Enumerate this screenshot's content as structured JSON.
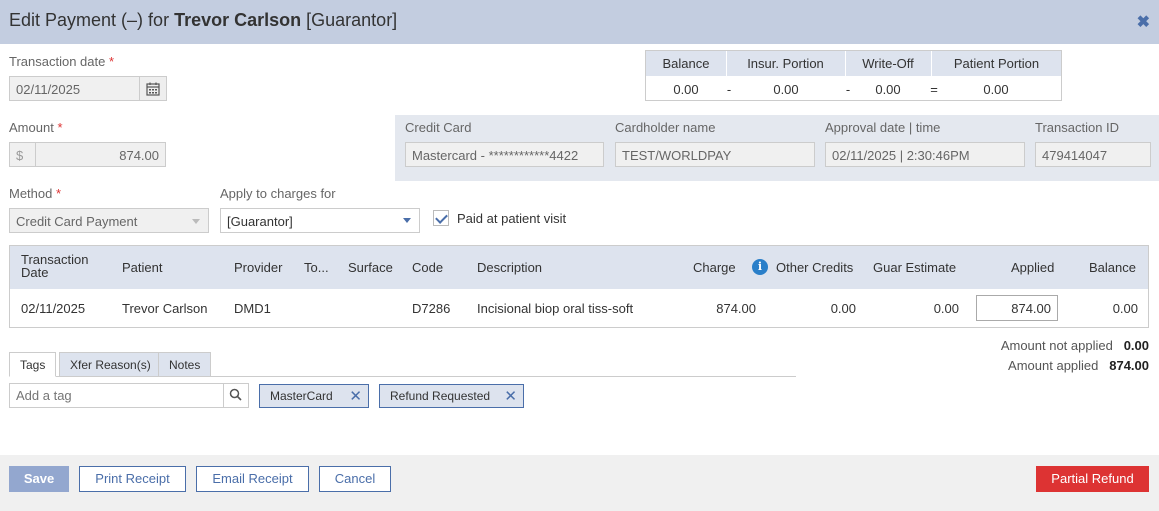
{
  "header": {
    "prefix": "Edit Payment (–) for",
    "name": "Trevor Carlson",
    "role": "[Guarantor]"
  },
  "transaction_date": {
    "label": "Transaction date",
    "required": "*",
    "value": "02/11/2025"
  },
  "summary": {
    "headers": [
      "Balance",
      "Insur. Portion",
      "Write-Off",
      "Patient Portion"
    ],
    "values": [
      "0.00",
      "0.00",
      "0.00",
      "0.00"
    ],
    "operators": [
      "-",
      "-",
      "="
    ]
  },
  "amount": {
    "label": "Amount",
    "required": "*",
    "currency": "$",
    "value": "874.00"
  },
  "credit_card": {
    "card_label": "Credit Card",
    "card_value": "Mastercard - ************4422",
    "holder_label": "Cardholder name",
    "holder_value": "TEST/WORLDPAY",
    "approval_label": "Approval date | time",
    "approval_value": "02/11/2025 | 2:30:46PM",
    "txn_label": "Transaction ID",
    "txn_value": "479414047"
  },
  "method": {
    "label": "Method",
    "required": "*",
    "value": "Credit Card Payment"
  },
  "apply_to": {
    "label": "Apply to charges for",
    "value": "[Guarantor]"
  },
  "paid_at_visit": {
    "label": "Paid at patient visit",
    "checked": true
  },
  "grid": {
    "headers": [
      "Transaction Date",
      "Patient",
      "Provider",
      "To...",
      "Surface",
      "Code",
      "Description",
      "Charge",
      "Other Credits",
      "Guar Estimate",
      "Applied",
      "Balance"
    ],
    "row": [
      "02/11/2025",
      "Trevor Carlson",
      "DMD1",
      "",
      "",
      "D7286",
      "Incisional biop oral tiss-soft",
      "874.00",
      "0.00",
      "0.00",
      "874.00",
      "0.00"
    ]
  },
  "totals": {
    "not_applied_label": "Amount not applied",
    "not_applied_value": "0.00",
    "applied_label": "Amount applied",
    "applied_value": "874.00"
  },
  "tabs": [
    "Tags",
    "Xfer Reason(s)",
    "Notes"
  ],
  "tag_input": {
    "placeholder": "Add a tag"
  },
  "tags": [
    "MasterCard",
    "Refund Requested"
  ],
  "buttons": {
    "save": "Save",
    "print": "Print Receipt",
    "email": "Email Receipt",
    "cancel": "Cancel",
    "refund": "Partial Refund"
  },
  "colors": {
    "accent": "#4a6ea9",
    "header_bg": "#c3cde0",
    "danger": "#dd3333"
  }
}
